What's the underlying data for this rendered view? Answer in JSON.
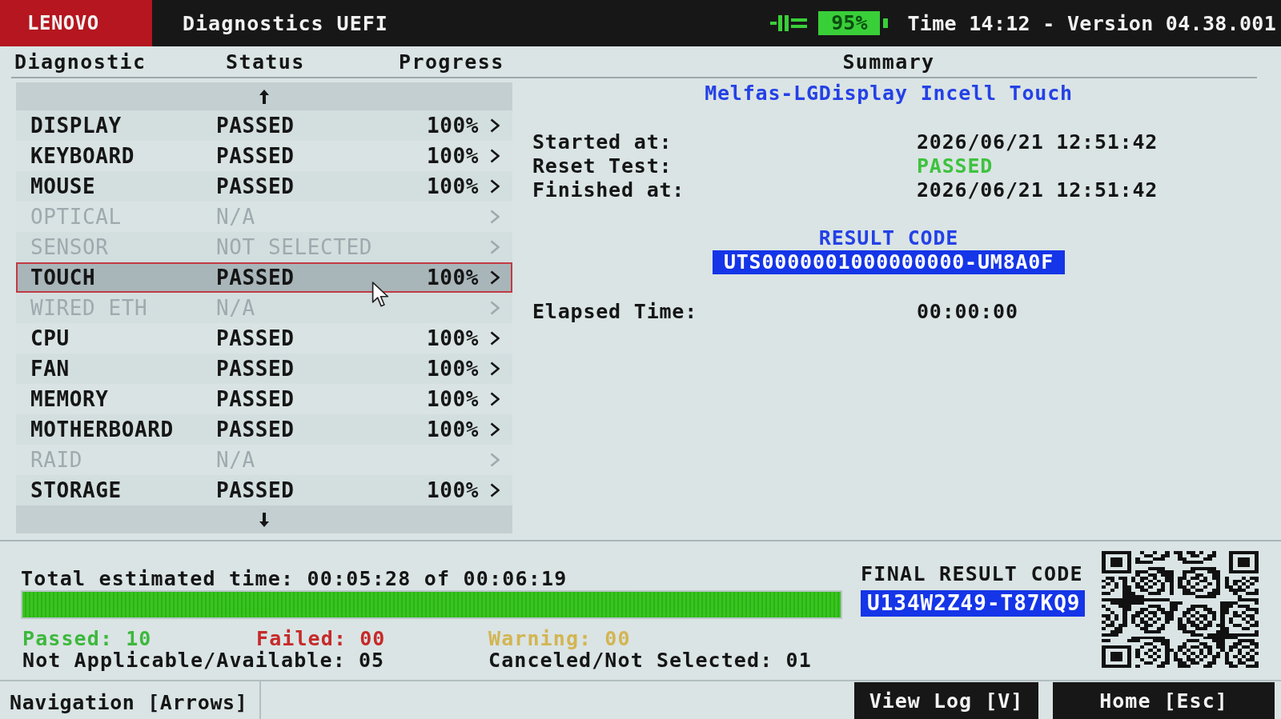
{
  "top_bar": {
    "logo": "LENOVO",
    "title": "Diagnostics UEFI",
    "battery": "95%",
    "status": "Time 14:12 - Version 04.38.001"
  },
  "columns": [
    "Diagnostic",
    "Status",
    "Progress"
  ],
  "diagnostics": [
    {
      "name": "DISPLAY",
      "status": "PASSED",
      "progress": "100%",
      "disabled": false,
      "selected": false
    },
    {
      "name": "KEYBOARD",
      "status": "PASSED",
      "progress": "100%",
      "disabled": false,
      "selected": false
    },
    {
      "name": "MOUSE",
      "status": "PASSED",
      "progress": "100%",
      "disabled": false,
      "selected": false
    },
    {
      "name": "OPTICAL",
      "status": "N/A",
      "disabled": true,
      "selected": false
    },
    {
      "name": "SENSOR",
      "status": "NOT SELECTED",
      "disabled": true,
      "selected": false
    },
    {
      "name": "TOUCH",
      "status": "PASSED",
      "progress": "100%",
      "disabled": false,
      "selected": true
    },
    {
      "name": "WIRED ETH",
      "status": "N/A",
      "disabled": true,
      "selected": false
    },
    {
      "name": "CPU",
      "status": "PASSED",
      "progress": "100%",
      "disabled": false,
      "selected": false
    },
    {
      "name": "FAN",
      "status": "PASSED",
      "progress": "100%",
      "disabled": false,
      "selected": false
    },
    {
      "name": "MEMORY",
      "status": "PASSED",
      "progress": "100%",
      "disabled": false,
      "selected": false
    },
    {
      "name": "MOTHERBOARD",
      "status": "PASSED",
      "progress": "100%",
      "disabled": false,
      "selected": false
    },
    {
      "name": "RAID",
      "status": "N/A",
      "disabled": true,
      "selected": false
    },
    {
      "name": "STORAGE",
      "status": "PASSED",
      "progress": "100%",
      "disabled": false,
      "selected": false
    }
  ],
  "summary": {
    "heading": "Summary",
    "device": "Melfas-LGDisplay Incell Touch",
    "fields": [
      {
        "label": "Started at:",
        "value": "2026/06/21 12:51:42",
        "color": "#151515"
      },
      {
        "label": "Reset Test:",
        "value": "PASSED",
        "color": "#3fc23f"
      },
      {
        "label": "Finished at:",
        "value": "2026/06/21 12:51:42",
        "color": "#151515"
      }
    ],
    "result_code_label": "RESULT CODE",
    "result_code": "UTS0000001000000000-UM8A0F",
    "elapsed": {
      "label": "Elapsed Time:",
      "value": "00:00:00"
    }
  },
  "totals": {
    "estimated": "Total estimated time: 00:05:28 of 00:06:19",
    "level": 1,
    "counts": [
      [
        {
          "label": "Passed: 10",
          "color": "#3db83d"
        },
        {
          "label": "Failed: 00",
          "color": "#c62a2a"
        },
        {
          "label": "Warning: 00",
          "color": "#d3b552"
        }
      ],
      [
        {
          "label": "Not Applicable/Available: 05",
          "color": "#151515"
        },
        {
          "label": "Canceled/Not Selected: 01",
          "color": "#151515"
        }
      ]
    ]
  },
  "final_result": {
    "label": "FINAL RESULT CODE",
    "code": "U134W2Z49-T87KQ9"
  },
  "footer": {
    "navigation": "Navigation [Arrows]",
    "buttons": [
      "View Log [V]",
      "Home [Esc]"
    ]
  }
}
